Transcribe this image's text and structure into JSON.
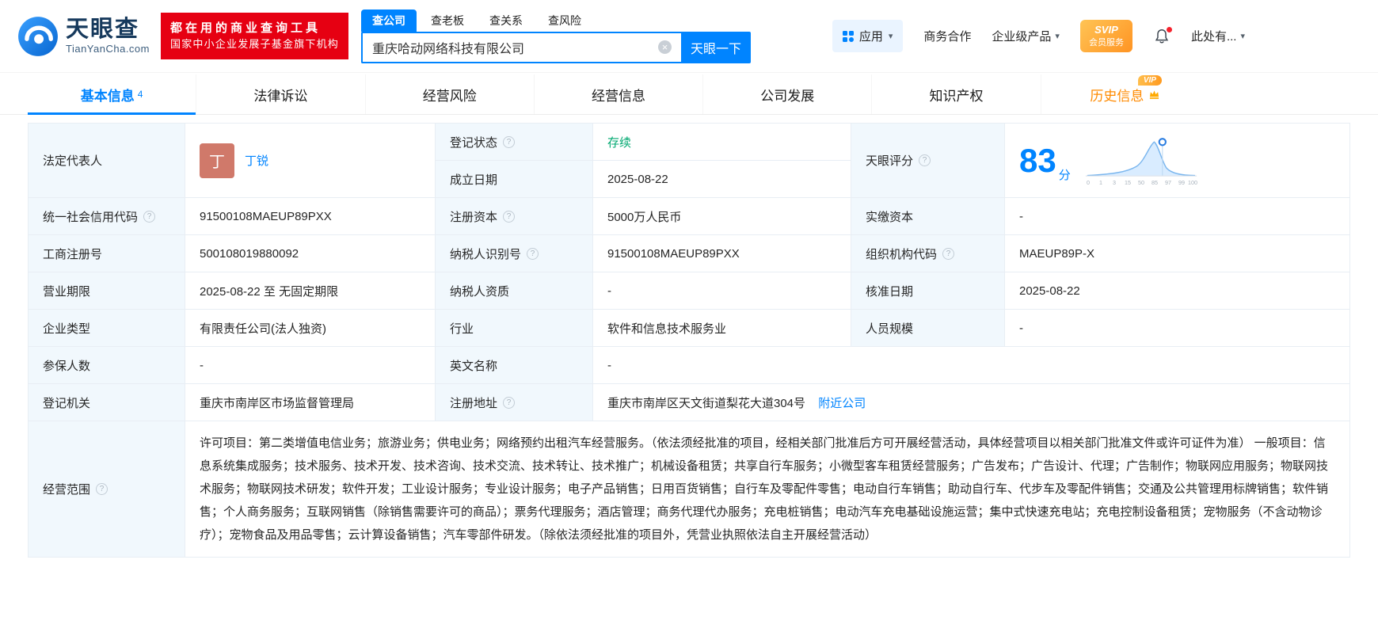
{
  "brand": {
    "name": "天眼查",
    "domain": "TianYanCha.com",
    "slogan_line1": "都在用的商业查询工具",
    "slogan_line2": "国家中小企业发展子基金旗下机构"
  },
  "icons": {
    "help": "?",
    "clear": "×",
    "caret_down": "▾"
  },
  "accent_colors": {
    "blue": "#0084ff",
    "green": "#00a870",
    "red": "#e60012",
    "orange": "#ff8a00"
  },
  "search": {
    "tabs": [
      {
        "label": "查公司",
        "active": true
      },
      {
        "label": "查老板",
        "active": false
      },
      {
        "label": "查关系",
        "active": false
      },
      {
        "label": "查风险",
        "active": false
      }
    ],
    "value": "重庆哈动网络科技有限公司",
    "button_label": "天眼一下"
  },
  "header_menu": {
    "apps": "应用",
    "business_coop": "商务合作",
    "enterprise_products": "企业级产品",
    "svip_line1": "SVIP",
    "svip_line2": "会员服务",
    "user_menu": "此处有..."
  },
  "nav_tabs": [
    {
      "label": "基本信息",
      "count": "4",
      "active": true
    },
    {
      "label": "法律诉讼"
    },
    {
      "label": "经营风险"
    },
    {
      "label": "经营信息"
    },
    {
      "label": "公司发展"
    },
    {
      "label": "知识产权"
    },
    {
      "label": "历史信息",
      "vip": "VIP"
    }
  ],
  "fields": {
    "legal_rep": {
      "label": "法定代表人",
      "avatar_char": "丁",
      "name": "丁锐"
    },
    "reg_status": {
      "label": "登记状态",
      "value": "存续"
    },
    "establish_date": {
      "label": "成立日期",
      "value": "2025-08-22"
    },
    "score": {
      "label": "天眼评分",
      "value": "83",
      "unit": "分"
    },
    "credit_code": {
      "label": "统一社会信用代码",
      "value": "91500108MAEUP89PXX"
    },
    "reg_capital": {
      "label": "注册资本",
      "value": "5000万人民币"
    },
    "paid_capital": {
      "label": "实缴资本",
      "value": "-"
    },
    "reg_number": {
      "label": "工商注册号",
      "value": "500108019880092"
    },
    "taxpayer_id": {
      "label": "纳税人识别号",
      "value": "91500108MAEUP89PXX"
    },
    "org_code": {
      "label": "组织机构代码",
      "value": "MAEUP89P-X"
    },
    "business_term": {
      "label": "营业期限",
      "value": "2025-08-22 至 无固定期限"
    },
    "taxpayer_quality": {
      "label": "纳税人资质",
      "value": "-"
    },
    "approval_date": {
      "label": "核准日期",
      "value": "2025-08-22"
    },
    "company_type": {
      "label": "企业类型",
      "value": "有限责任公司(法人独资)"
    },
    "industry": {
      "label": "行业",
      "value": "软件和信息技术服务业"
    },
    "staff_size": {
      "label": "人员规模",
      "value": "-"
    },
    "insured_count": {
      "label": "参保人数",
      "value": "-"
    },
    "english_name": {
      "label": "英文名称",
      "value": "-"
    },
    "reg_authority": {
      "label": "登记机关",
      "value": "重庆市南岸区市场监督管理局"
    },
    "reg_address": {
      "label": "注册地址",
      "value": "重庆市南岸区天文街道梨花大道304号",
      "link": "附近公司"
    },
    "business_scope": {
      "label": "经营范围",
      "value": "许可项目：第二类增值电信业务；旅游业务；供电业务；网络预约出租汽车经营服务。（依法须经批准的项目，经相关部门批准后方可开展经营活动，具体经营项目以相关部门批准文件或许可证件为准） 一般项目：信息系统集成服务；技术服务、技术开发、技术咨询、技术交流、技术转让、技术推广；机械设备租赁；共享自行车服务；小微型客车租赁经营服务；广告发布；广告设计、代理；广告制作；物联网应用服务；物联网技术服务；物联网技术研发；软件开发；工业设计服务；专业设计服务；电子产品销售；日用百货销售；自行车及零配件零售；电动自行车销售；助动自行车、代步车及零配件销售；交通及公共管理用标牌销售；软件销售；个人商务服务；互联网销售（除销售需要许可的商品）；票务代理服务；酒店管理；商务代理代办服务；充电桩销售；电动汽车充电基础设施运营；集中式快速充电站；充电控制设备租赁；宠物服务（不含动物诊疗）；宠物食品及用品零售；云计算设备销售；汽车零部件研发。（除依法须经批准的项目外，凭营业执照依法自主开展经营活动）"
    }
  },
  "score_chart": {
    "type": "area",
    "description": "score distribution curve with marker at company score",
    "score": 83,
    "ticks": [
      "0",
      "1",
      "3",
      "15",
      "50",
      "85",
      "97",
      "99",
      "100"
    ]
  }
}
